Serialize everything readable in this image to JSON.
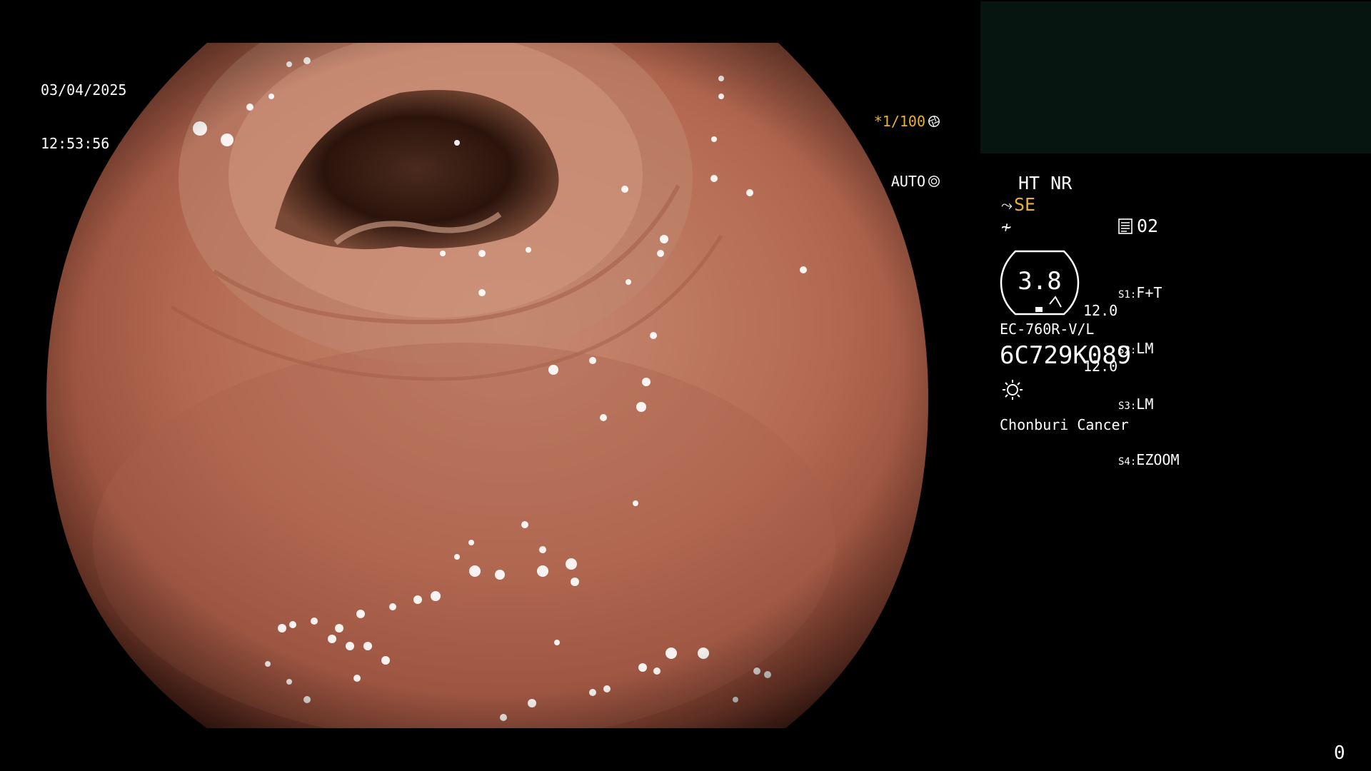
{
  "overlay": {
    "date": "03/04/2025",
    "time": "12:53:56",
    "shutter_speed": "*1/100",
    "iris_mode": "AUTO",
    "enhancement_modes": "HT NR",
    "structure_enhancement": "SE",
    "memory_label": "02",
    "gauge_value": "3.8",
    "gauge_side_values": [
      "12.0",
      "12.0"
    ],
    "switches": [
      {
        "key": "S1:",
        "value": "F+T"
      },
      {
        "key": "S2:",
        "value": "LM"
      },
      {
        "key": "S3:",
        "value": "LM"
      },
      {
        "key": "S4:",
        "value": "EZOOM"
      }
    ],
    "scope_model": "EC-760R-V/L",
    "scope_serial": "6C729K089",
    "institution": "Chonburi Cancer",
    "frame_counter": "0"
  },
  "colors": {
    "accent_yellow": "#e8b230",
    "panel_dark": "#061510",
    "tissue": "#b46a52"
  },
  "icons": [
    "shutter-icon",
    "iris-icon",
    "scope-tip-icon",
    "freeze-icon",
    "memory-icon",
    "light-source-icon"
  ]
}
